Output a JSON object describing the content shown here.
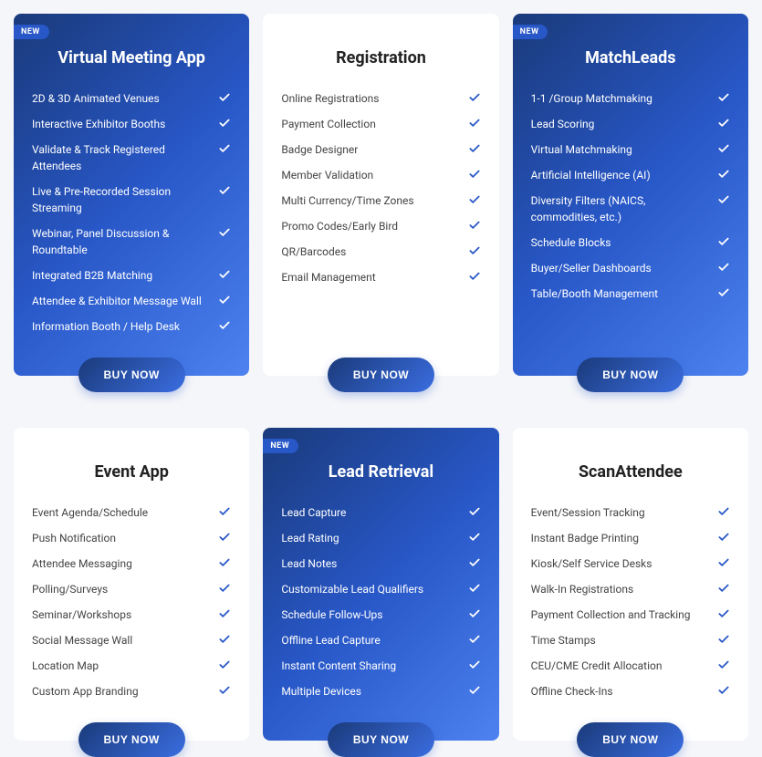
{
  "buy_label": "BUY NOW",
  "new_label": "NEW",
  "cards": [
    {
      "title": "Virtual Meeting App",
      "new": true,
      "theme": "blue",
      "features": [
        "2D & 3D Animated Venues",
        "Interactive Exhibitor Booths",
        "Validate & Track Registered Attendees",
        "Live & Pre-Recorded Session Streaming",
        "Webinar, Panel Discussion & Roundtable",
        "Integrated B2B Matching",
        "Attendee & Exhibitor Message Wall",
        "Information Booth / Help Desk"
      ]
    },
    {
      "title": "Registration",
      "new": false,
      "theme": "white",
      "features": [
        "Online Registrations",
        "Payment Collection",
        "Badge Designer",
        "Member Validation",
        "Multi Currency/Time Zones",
        "Promo Codes/Early Bird",
        "QR/Barcodes",
        "Email Management"
      ]
    },
    {
      "title": "MatchLeads",
      "new": true,
      "theme": "blue",
      "features": [
        "1-1 /Group Matchmaking",
        "Lead Scoring",
        "Virtual Matchmaking",
        "Artificial Intelligence (AI)",
        "Diversity Filters (NAICS, commodities, etc.)",
        "Schedule Blocks",
        "Buyer/Seller Dashboards",
        "Table/Booth Management"
      ]
    },
    {
      "title": "Event App",
      "new": false,
      "theme": "white",
      "features": [
        "Event Agenda/Schedule",
        "Push Notification",
        "Attendee Messaging",
        "Polling/Surveys",
        "Seminar/Workshops",
        "Social Message Wall",
        "Location Map",
        "Custom App Branding"
      ]
    },
    {
      "title": "Lead Retrieval",
      "new": true,
      "theme": "blue",
      "features": [
        "Lead Capture",
        "Lead Rating",
        "Lead Notes",
        "Customizable Lead Qualifiers",
        "Schedule Follow-Ups",
        "Offline Lead Capture",
        "Instant Content Sharing",
        "Multiple Devices"
      ]
    },
    {
      "title": "ScanAttendee",
      "new": false,
      "theme": "white",
      "features": [
        "Event/Session Tracking",
        "Instant Badge Printing",
        "Kiosk/Self Service Desks",
        "Walk-In Registrations",
        "Payment Collection and Tracking",
        "Time Stamps",
        "CEU/CME Credit Allocation",
        "Offline Check-Ins"
      ]
    }
  ]
}
